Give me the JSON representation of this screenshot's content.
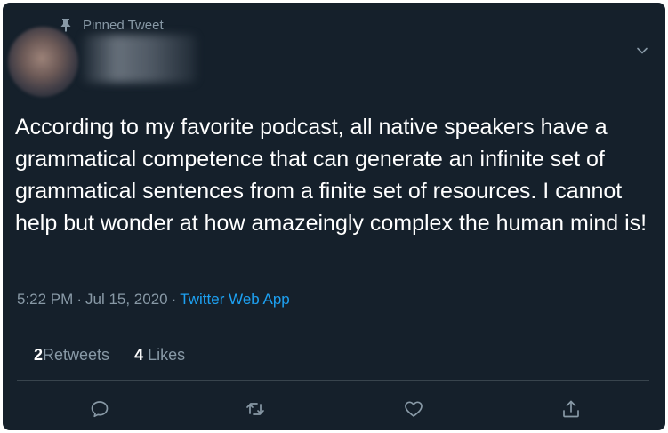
{
  "pinned": {
    "label": "Pinned Tweet",
    "icon": "pin-icon"
  },
  "tweet": {
    "text": "According to my favorite podcast, all native speakers have a grammatical competence that can generate an infinite set of grammatical sentences from a finite set of resources. I cannot help but wonder at how amazeingly complex the human mind is!",
    "time": "5:22 PM",
    "date": "Jul 15, 2020",
    "source": "Twitter Web App"
  },
  "stats": {
    "retweets_count": "2",
    "retweets_label": "Retweets",
    "likes_count": "4",
    "likes_label": "Likes"
  },
  "actions": [
    "reply-icon",
    "retweet-icon",
    "like-icon",
    "share-icon"
  ],
  "colors": {
    "background": "#15202b",
    "text": "#ffffff",
    "muted": "#8899a6",
    "accent": "#1da1f2",
    "divider": "#38444d"
  }
}
